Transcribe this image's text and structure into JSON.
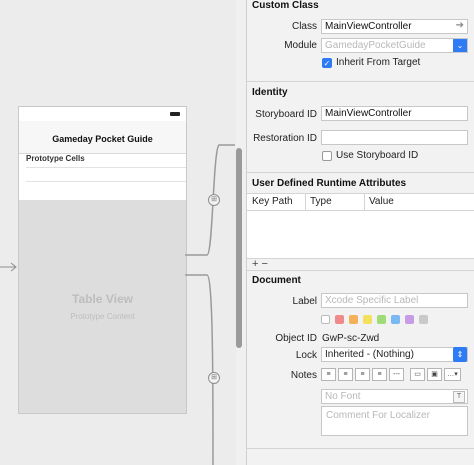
{
  "canvas": {
    "scene_title": "Gameday Pocket Guide",
    "prototype_cells": "Prototype Cells",
    "table_view_title": "Table View",
    "table_view_subtitle": "Prototype Content",
    "dot_colors": [
      "#f6a623",
      "#f0653a",
      "#e5533d"
    ]
  },
  "inspector": {
    "custom_class": {
      "title": "Custom Class",
      "class_label": "Class",
      "class_value": "MainViewController",
      "module_label": "Module",
      "module_placeholder": "GamedayPocketGuide",
      "inherit_label": "Inherit From Target",
      "inherit_checked": true
    },
    "identity": {
      "title": "Identity",
      "storyboard_id_label": "Storyboard ID",
      "storyboard_id_value": "MainViewController",
      "restoration_id_label": "Restoration ID",
      "restoration_id_value": "",
      "use_storyboard_id_label": "Use Storyboard ID"
    },
    "udra": {
      "title": "User Defined Runtime Attributes",
      "col_key_path": "Key Path",
      "col_type": "Type",
      "col_value": "Value",
      "add_remove": "+ −"
    },
    "document": {
      "title": "Document",
      "label_label": "Label",
      "label_placeholder": "Xcode Specific Label",
      "swatch_colors": [
        "#ffffff",
        "#f08a8a",
        "#f5b15a",
        "#f3e05c",
        "#9fdc75",
        "#79b8f0",
        "#c79be6",
        "#c9c9c9"
      ],
      "object_id_label": "Object ID",
      "object_id_value": "GwP-sc-Zwd",
      "lock_label": "Lock",
      "lock_value": "Inherited - (Nothing)",
      "notes_label": "Notes",
      "font_placeholder": "No Font",
      "comment_placeholder": "Comment For Localizer"
    }
  }
}
